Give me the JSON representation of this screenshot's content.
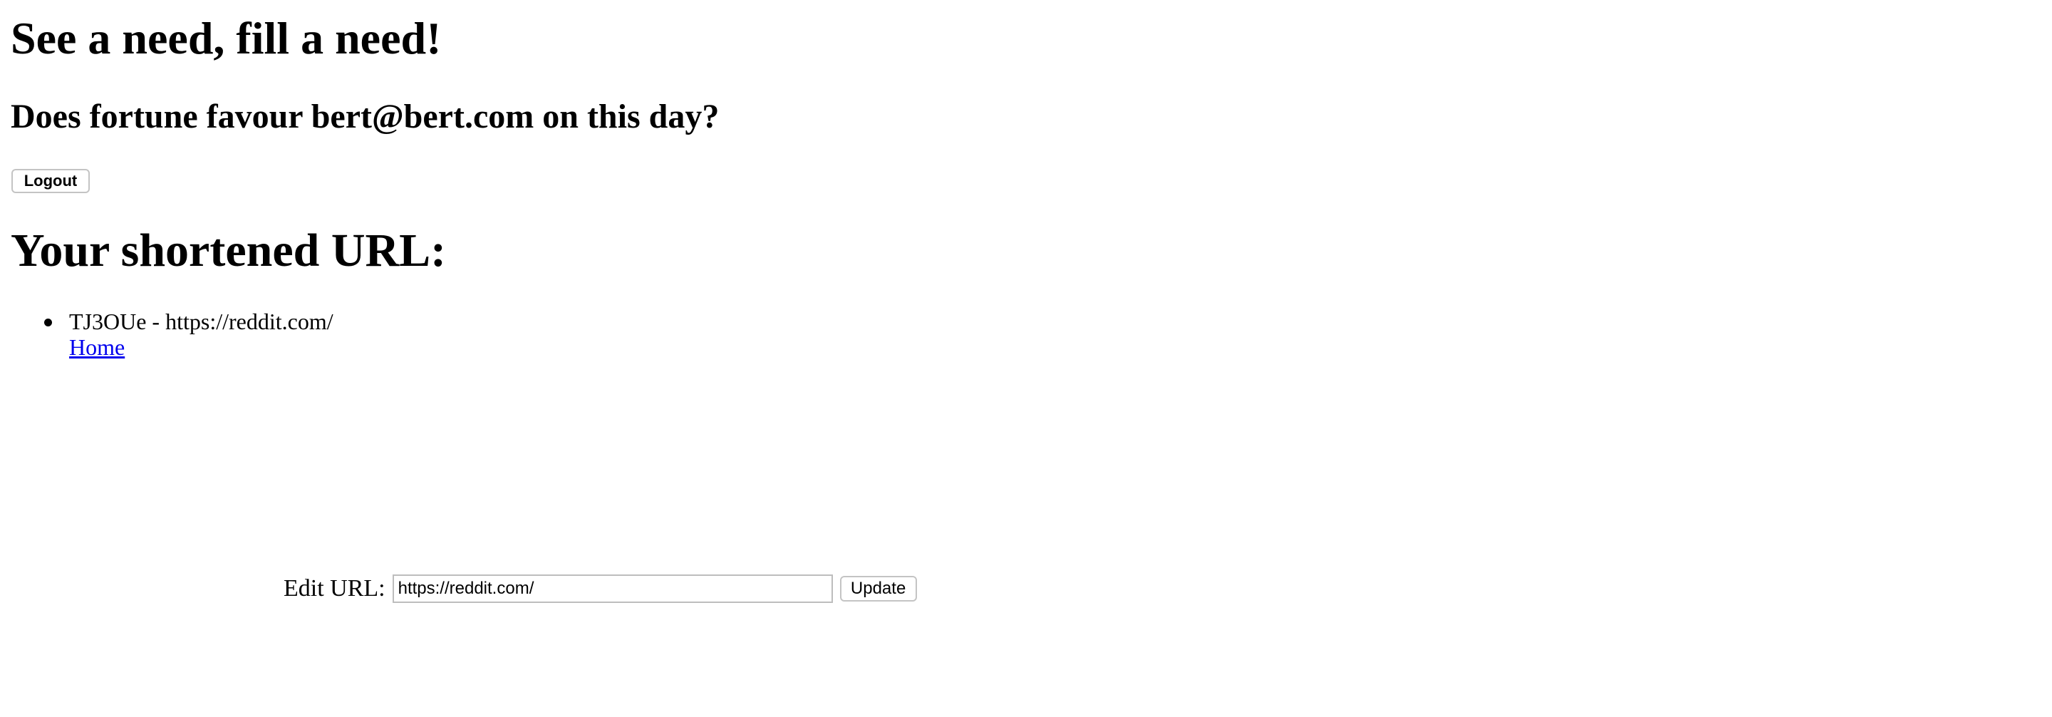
{
  "header": {
    "title": "See a need, fill a need!",
    "greeting": "Does fortune favour bert@bert.com on this day?",
    "logout_label": "Logout"
  },
  "main": {
    "heading": "Your shortened URL:",
    "urls": [
      {
        "entry": "TJ3OUe - https://reddit.com/",
        "home_link": "Home"
      }
    ]
  },
  "edit_form": {
    "label": "Edit URL:",
    "value": "https://reddit.com/",
    "update_label": "Update"
  }
}
